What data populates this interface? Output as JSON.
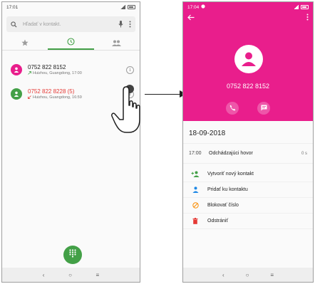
{
  "left_screen": {
    "status_time": "17:01",
    "search_placeholder": "Hľadať v kontakt.",
    "tabs": [
      {
        "icon": "star-icon",
        "active": false
      },
      {
        "icon": "clock-icon",
        "active": true
      },
      {
        "icon": "people-icon",
        "active": false
      }
    ],
    "calls": [
      {
        "number": "0752 822 8152",
        "location": "Huizhou, Guangdong, 17:00",
        "type": "outgoing",
        "avatar_color": "#e91e8c"
      },
      {
        "number": "0752 822 8228 (5)",
        "location": "Huizhou, Guangdong, 16:59",
        "type": "missed",
        "avatar_color": "#43a047"
      }
    ],
    "nav": [
      "‹",
      "○",
      "≡"
    ]
  },
  "right_screen": {
    "status_time": "17:04",
    "contact_number": "0752 822 8152",
    "date": "18-09-2018",
    "call_time": "17:00",
    "call_label": "Odchádzajúci hovor",
    "call_duration": "0 s",
    "actions": [
      {
        "label": "Vytvoriť nový kontakt",
        "icon": "add-person-icon",
        "color": "#43a047"
      },
      {
        "label": "Pridať ku kontaktu",
        "icon": "person-icon",
        "color": "#1e88e5"
      },
      {
        "label": "Blokovať číslo",
        "icon": "block-icon",
        "color": "#fb8c00"
      },
      {
        "label": "Odstrániť",
        "icon": "trash-icon",
        "color": "#e53935"
      }
    ],
    "nav": [
      "‹",
      "○",
      "≡"
    ],
    "header_color": "#e91e8c"
  },
  "colors": {
    "accent_green": "#43a047",
    "missed_red": "#e53935"
  }
}
